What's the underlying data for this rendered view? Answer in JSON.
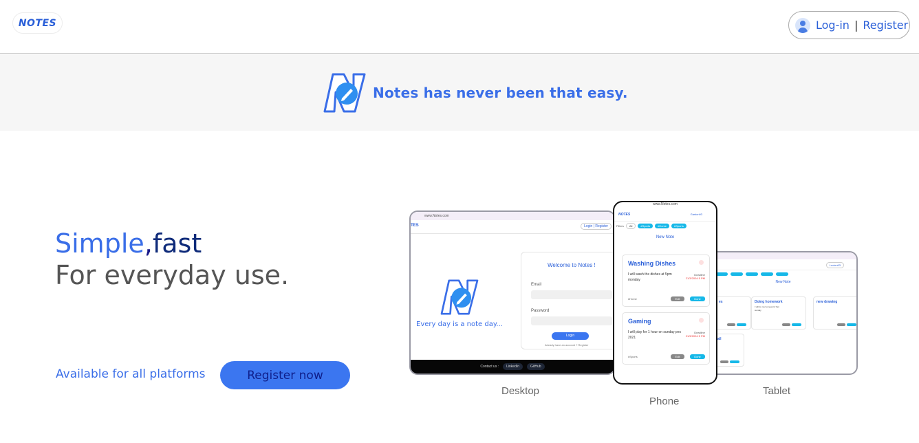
{
  "header": {
    "logo_text": "NOTES",
    "login_label": "Log-in",
    "separator": "|",
    "register_label": "Register"
  },
  "banner": {
    "text": "Notes has never been that easy."
  },
  "hero": {
    "simple": "Simple",
    "comma": ",",
    "fast": "fast",
    "line2": "For everyday use.",
    "available": "Available for all platforms",
    "register_button": "Register now"
  },
  "devices": {
    "desktop_label": "Desktop",
    "phone_label": "Phone",
    "tablet_label": "Tablet"
  },
  "desktop_screen": {
    "url": "www.Notes.com",
    "logo": "TES",
    "auth": "Login | Register",
    "tagline": "Every day is a note day...",
    "welcome": "Welcome to Notes !",
    "email_label": "Email",
    "password_label": "Password",
    "login_button": "Login",
    "already": "Already have an account ? Register",
    "contact": "Contact us :",
    "linkedin": "LinkedIn",
    "github": "GitHub"
  },
  "phone_screen": {
    "url": "www.Notes.com",
    "logo": "NOTES",
    "user": "Gaston93",
    "filters_label": "Filters",
    "filter_all": "All",
    "filters": [
      "#Sports",
      "#Home",
      "#Sports"
    ],
    "new_note": "New Note",
    "notes": [
      {
        "title": "Washing Dishes",
        "body": "I will wash the dishes at 5pm monday",
        "deadline": "Deadline",
        "date": "21/3/2004 5 PM",
        "tag": "#Home",
        "edit": "Edit",
        "done": "Done"
      },
      {
        "title": "Gaming",
        "body": "I will play for 1 hour on sunday pes 2021",
        "deadline": "Deadline",
        "date": "21/3/2004 5 PM",
        "tag": "#Sports",
        "edit": "Edit",
        "done": "Done"
      }
    ]
  },
  "tablet_screen": {
    "auth": "Lucien93",
    "new_note": "New Note",
    "notes": [
      {
        "title": "es",
        "body": ""
      },
      {
        "title": "Doing homework",
        "body": "I will do my homework 7am sunday"
      },
      {
        "title": "new drawing",
        "body": ""
      },
      {
        "title": "all",
        "body": ""
      }
    ]
  },
  "colors": {
    "accent": "#3a6ee8",
    "button": "#3b76f0",
    "dark_blue": "#0f2b7a",
    "banner_bg": "#f6f6f6"
  }
}
